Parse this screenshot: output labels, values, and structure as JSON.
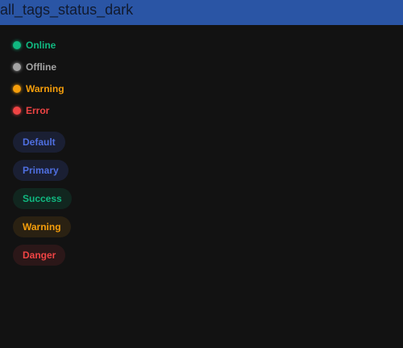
{
  "title": "all_tags_status_dark",
  "statuses": [
    {
      "label": "Online",
      "color": "#10b981"
    },
    {
      "label": "Offline",
      "color": "#a3a3a3"
    },
    {
      "label": "Warning",
      "color": "#f59e0b"
    },
    {
      "label": "Error",
      "color": "#ef4444"
    }
  ],
  "tags": [
    {
      "label": "Default",
      "color": "#4f6fe0",
      "bg": "#1a1f33"
    },
    {
      "label": "Primary",
      "color": "#4f6fe0",
      "bg": "#1a1f33"
    },
    {
      "label": "Success",
      "color": "#10b981",
      "bg": "#11261f"
    },
    {
      "label": "Warning",
      "color": "#f59e0b",
      "bg": "#2a2112"
    },
    {
      "label": "Danger",
      "color": "#ef4444",
      "bg": "#2b1718"
    }
  ]
}
